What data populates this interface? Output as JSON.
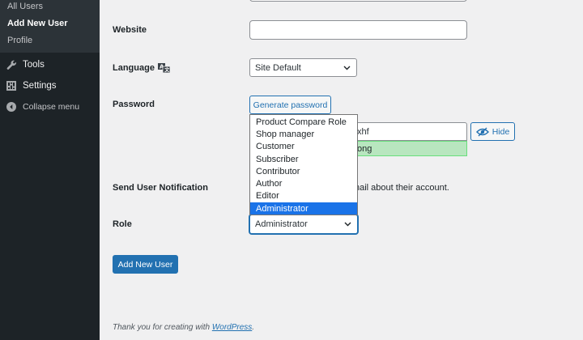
{
  "sidebar": {
    "submenu": [
      "All Users",
      "Add New User",
      "Profile"
    ],
    "items": [
      {
        "label": "Tools",
        "icon": "wrench-icon"
      },
      {
        "label": "Settings",
        "icon": "settings-icon"
      },
      {
        "label": "Collapse menu",
        "icon": "collapse-icon"
      }
    ]
  },
  "form": {
    "website_label": "Website",
    "website_value": "",
    "language_label": "Language",
    "language_value": "Site Default",
    "password_label": "Password",
    "generate_password_label": "Generate password",
    "password_value_visible": "xhf",
    "hide_label": "Hide",
    "strength_visible": "ong",
    "notification_label": "Send User Notification",
    "notification_text_visible": "nail about their account.",
    "role_label": "Role",
    "role_value": "Administrator",
    "role_options": [
      "Product Compare Role",
      "Shop manager",
      "Customer",
      "Subscriber",
      "Contributor",
      "Author",
      "Editor",
      "Administrator"
    ],
    "submit_label": "Add New User"
  },
  "footer": {
    "text": "Thank you for creating with ",
    "link": "WordPress",
    "end": "."
  },
  "colors": {
    "sidebar": "#1d2327",
    "accent": "#2271b1",
    "highlight": "#1a73e8",
    "strength_bg": "#b8e6bf"
  }
}
